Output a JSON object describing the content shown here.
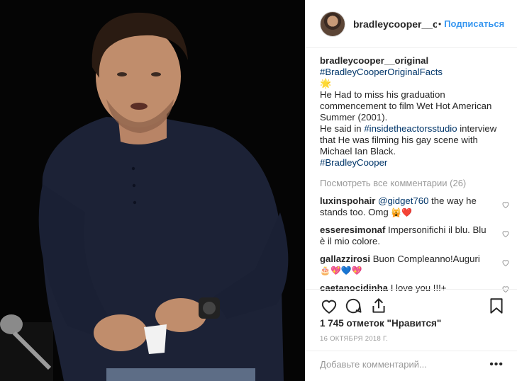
{
  "post": {
    "photo_label": "Bradley Cooper on stage holding a paper cup",
    "photo_icon": "photo"
  },
  "header": {
    "username": "bradleycooper__original",
    "separator": "•",
    "follow_label": "Подписаться"
  },
  "caption": {
    "author": "bradleycooper__original",
    "hashtag_top": "#BradleyCooperOriginalFacts",
    "star": "🌟",
    "line1": "He Had to miss his graduation commencement to film Wet Hot American Summer (2001).",
    "line2_before": "He said in ",
    "line2_tag": "#insidetheactorsstudio",
    "line2_after": " interview that He was filming his gay scene with Michael Ian Black.",
    "hashtag_bottom": "#BradleyCooper"
  },
  "view_all": "Посмотреть все комментарии (26)",
  "comments": [
    {
      "user": "luxinspohair",
      "mention": "@gidget760",
      "text": " the way he stands too. Omg ",
      "emoji": "🙀❤️"
    },
    {
      "user": "esseresimonaf",
      "mention": "",
      "text": "Impersonifichi il blu. Blu è il mio colore.",
      "emoji": ""
    },
    {
      "user": "gallazzirosi",
      "mention": "",
      "text": "Buon Compleanno!Auguri ",
      "emoji": "🎂💖💙💖"
    },
    {
      "user": "caetanocidinha",
      "mention": "",
      "text": "I love you !!!+",
      "emoji": ""
    }
  ],
  "likes": "1 745 отметок \"Нравится\"",
  "date": "16 ОКТЯБРЯ 2018 Г.",
  "add_comment": {
    "placeholder": "Добавьте комментарий...",
    "more": "•••"
  },
  "icons": [
    "heart-icon",
    "comment-icon",
    "share-icon",
    "bookmark-icon"
  ],
  "colors": {
    "link": "#003569",
    "follow": "#3897f0",
    "muted": "#999999",
    "border": "#efefef"
  }
}
